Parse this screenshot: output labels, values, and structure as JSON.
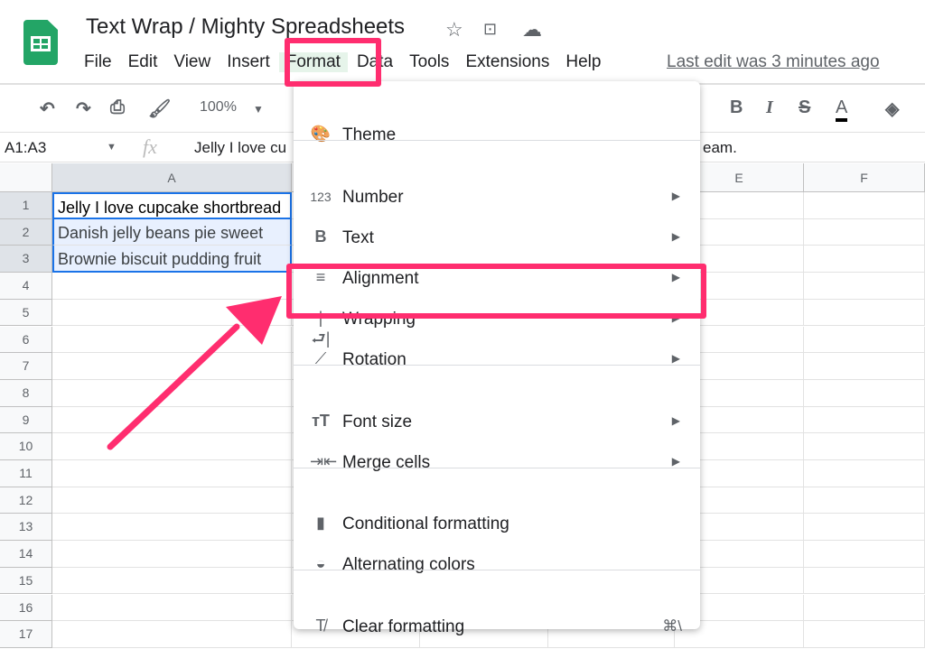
{
  "app": {
    "title": "Text Wrap / Mighty Spreadsheets",
    "icons": [
      "star-icon",
      "move-folder-icon",
      "cloud-status-icon"
    ]
  },
  "menubar": {
    "items": [
      "File",
      "Edit",
      "View",
      "Insert",
      "Format",
      "Data",
      "Tools",
      "Extensions",
      "Help"
    ],
    "last_edit": "Last edit was 3 minutes ago",
    "active": "Format"
  },
  "toolbar": {
    "zoom": "100%"
  },
  "formula_bar": {
    "name_box": "A1:A3",
    "fx": "fx",
    "content_start": "Jelly I love cu",
    "content_end": "eam."
  },
  "grid": {
    "columns": [
      "A",
      "",
      "",
      "",
      "E",
      "F"
    ],
    "rows": [
      "1",
      "2",
      "3",
      "4",
      "5",
      "6",
      "7",
      "8",
      "9",
      "10",
      "11",
      "12",
      "13",
      "14",
      "15",
      "16",
      "17"
    ],
    "cells": [
      "Jelly I love cupcake shortbread",
      "Danish jelly beans pie sweet",
      "Brownie biscuit pudding fruit"
    ]
  },
  "format_menu": {
    "items": [
      {
        "label": "Theme",
        "icon": "palette-icon"
      },
      {
        "label": "Number",
        "icon": "number-123-icon",
        "submenu": true
      },
      {
        "label": "Text",
        "icon": "bold-icon",
        "submenu": true
      },
      {
        "label": "Alignment",
        "icon": "align-left-icon",
        "submenu": true
      },
      {
        "label": "Wrapping",
        "icon": "wrap-icon",
        "submenu": true,
        "highlighted": true
      },
      {
        "label": "Rotation",
        "icon": "rotation-icon",
        "submenu": true
      },
      {
        "label": "Font size",
        "icon": "font-size-icon",
        "submenu": true
      },
      {
        "label": "Merge cells",
        "icon": "merge-icon",
        "submenu": true
      },
      {
        "label": "Conditional formatting",
        "icon": "paint-roller-icon"
      },
      {
        "label": "Alternating colors",
        "icon": "color-drop-icon"
      },
      {
        "label": "Clear formatting",
        "icon": "clear-format-icon",
        "shortcut": "⌘\\"
      }
    ]
  },
  "colors": {
    "highlight": "#ff2d6f",
    "selection": "#e8f0fe",
    "brand": "#23a566"
  }
}
